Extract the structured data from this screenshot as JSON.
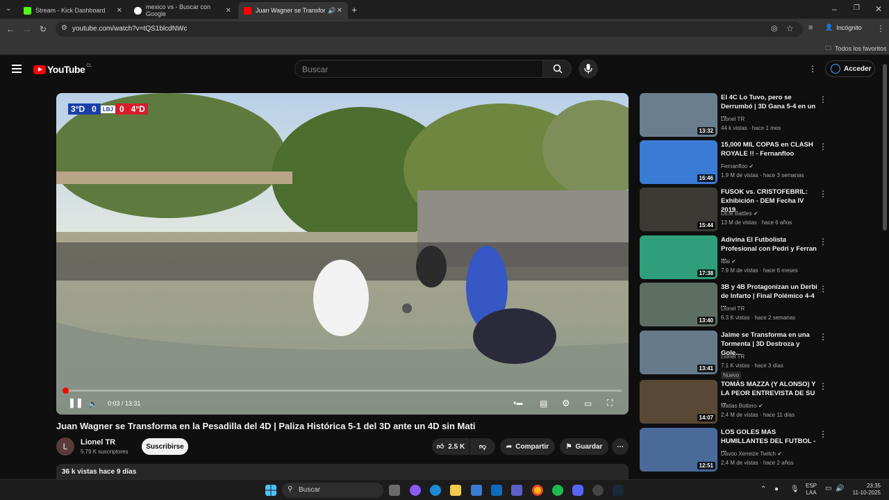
{
  "browser": {
    "tabs": [
      {
        "label": "Stream - Kick Dashboard",
        "favicon_color": "#53fc18"
      },
      {
        "label": "mexico vs - Buscar con Google",
        "favicon_color": "#4285f4"
      },
      {
        "label": "Juan Wagner se Transforma",
        "favicon_color": "#ff0000"
      }
    ],
    "url": "youtube.com/watch?v=tQS1blcdNWc",
    "incognito_label": "Incógnito",
    "bookmarks_label": "Todos los favoritos"
  },
  "youtube": {
    "logo_text": "YouTube",
    "region": "CL",
    "search_placeholder": "Buscar",
    "signin_label": "Acceder"
  },
  "video": {
    "scoreboard": {
      "left": "3°D",
      "left_score": "0",
      "right_score": "0",
      "right": "4°D"
    },
    "time": "0:03 / 13:31",
    "progress": 0.004,
    "title": "Juan Wagner se Transforma en la Pesadilla del 4D | Paliza Histórica 5-1 del 3D ante un 4D sin Mati",
    "channel": "Lionel TR",
    "channel_initial": "L",
    "subscribers": "5.79 K suscriptores",
    "subscribe_label": "Suscribirse",
    "likes": "2.5 K",
    "share_label": "Compartir",
    "save_label": "Guardar",
    "views_date": "36 k vistas  hace 9 días"
  },
  "recommendations": [
    {
      "title": "El 4C Lo Tuvo, pero se Derrumbó | 3D Gana 5-4 en un ...",
      "channel": "Lionel TR",
      "meta": "44 k vistas · hace 1 mes",
      "duration": "13:32",
      "thumb_color": "#6b7e8f",
      "verified": false
    },
    {
      "title": "15,000 MIL COPAS en CLASH ROYALE !! - Fernanfloo",
      "channel": "Fernanfloo",
      "meta": "1.9 M de vistas · hace 3 semanas",
      "duration": "16:46",
      "thumb_color": "#3a7bd5",
      "verified": true
    },
    {
      "title": "FUSOK vs. CRISTOFEBRIL: Exhibición - DEM Fecha IV 2019",
      "channel": "DEM Battles",
      "meta": "13 M de vistas · hace 6 años",
      "duration": "15:44",
      "thumb_color": "#3b3a34",
      "verified": true
    },
    {
      "title": "Adivina El Futbolista Profesional con Pedri y Ferran ...",
      "channel": "Ibai",
      "meta": "7.9 M de vistas · hace 6 meses",
      "duration": "17:38",
      "thumb_color": "#2f9e7a",
      "verified": true
    },
    {
      "title": "3B y 4B Protagonizan un Derbi de Infarto | Final Polémico 4-4 ...",
      "channel": "Lionel TR",
      "meta": "6.3 K vistas · hace 2 semanas",
      "duration": "13:40",
      "thumb_color": "#5d6f62",
      "verified": false
    },
    {
      "title": "Jaime se Transforma en una Tormenta | 3D Destroza y Gole...",
      "channel": "Lionel TR",
      "meta": "7.1 K vistas · hace 3 días",
      "duration": "13:41",
      "thumb_color": "#667a8a",
      "verified": false,
      "badge": "Nuevo"
    },
    {
      "title": "TOMÁS MAZZA (Y ALONSO) Y LA PEOR ENTREVISTA DE SU ...",
      "channel": "Matias Bottero",
      "meta": "2.4 M de vistas · hace 11 días",
      "duration": "14:07",
      "thumb_color": "#5a4836",
      "verified": true
    },
    {
      "title": "LOS GOLES MAS HUMILLANTES DEL FUTBOL - ...",
      "channel": "Davoo Xeneize Twitch",
      "meta": "2.4 M de vistas · hace 2 años",
      "duration": "12:51",
      "thumb_color": "#4a6a9a",
      "verified": true
    }
  ],
  "taskbar": {
    "search_placeholder": "Buscar",
    "lang": "ESP",
    "lang2": "LAA",
    "time": "23:35",
    "date": "11-10-2025"
  },
  "colors": {
    "yt_red": "#ff0000",
    "accent_blue": "#3ea6ff"
  }
}
